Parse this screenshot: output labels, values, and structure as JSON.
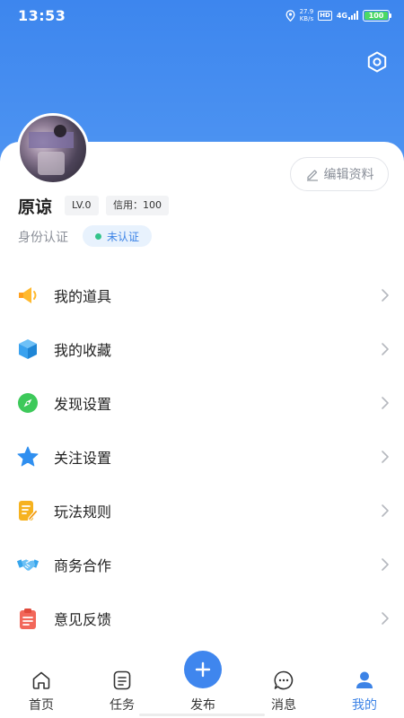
{
  "status_bar": {
    "time": "13:53",
    "net_speed_value": "27.9",
    "net_speed_unit": "KB/s",
    "hd": "HD",
    "network": "4G",
    "battery": "100"
  },
  "header": {
    "settings_icon": "hexagon-settings-icon"
  },
  "profile": {
    "username": "原谅",
    "level": "LV.0",
    "credit": "信用：100",
    "auth_label": "身份认证",
    "auth_status": "未认证",
    "edit_label": "编辑资料"
  },
  "menu": {
    "items": [
      {
        "label": "我的道具",
        "icon": "megaphone-icon",
        "color": "#ffb92e"
      },
      {
        "label": "我的收藏",
        "icon": "cube-icon",
        "color": "#3aa2ef"
      },
      {
        "label": "发现设置",
        "icon": "compass-icon",
        "color": "#3dc95a"
      },
      {
        "label": "关注设置",
        "icon": "star-icon",
        "color": "#2f8ff0"
      },
      {
        "label": "玩法规则",
        "icon": "note-pen-icon",
        "color": "#f6b21f"
      },
      {
        "label": "商务合作",
        "icon": "handshake-icon",
        "color": "#37a5ec"
      },
      {
        "label": "意见反馈",
        "icon": "clipboard-icon",
        "color": "#f2675a"
      }
    ]
  },
  "tabbar": {
    "tabs": [
      {
        "label": "首页",
        "icon": "home-icon"
      },
      {
        "label": "任务",
        "icon": "task-list-icon"
      },
      {
        "label": "发布",
        "icon": "plus-icon"
      },
      {
        "label": "消息",
        "icon": "chat-bubble-icon"
      },
      {
        "label": "我的",
        "icon": "user-icon"
      }
    ],
    "active_tab": "我的",
    "accent_color": "#3c83e6"
  }
}
